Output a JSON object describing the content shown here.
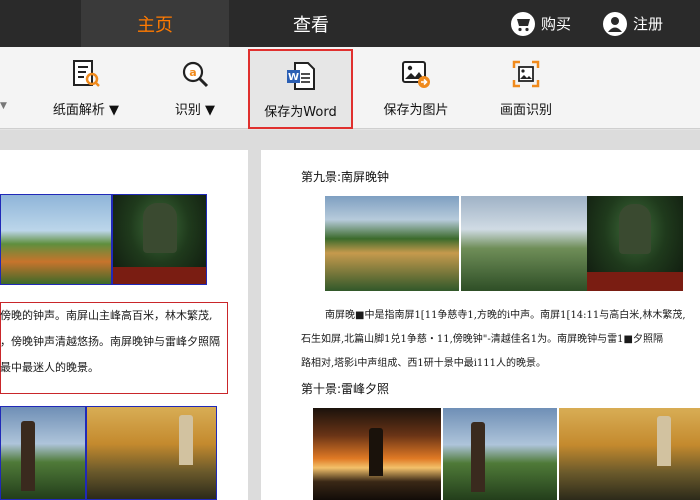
{
  "topbar": {
    "tabs": [
      {
        "label": "主页",
        "active": true
      },
      {
        "label": "查看",
        "active": false
      }
    ],
    "buy_label": "购买",
    "register_label": "注册"
  },
  "ribbon": {
    "buttons": [
      {
        "label": "纸面解析 ▼",
        "icon": "doc-search-icon"
      },
      {
        "label": "识别 ▼",
        "icon": "ocr-magnifier-icon"
      },
      {
        "label": "保存为Word",
        "icon": "word-doc-icon",
        "highlighted": true
      },
      {
        "label": "保存为图片",
        "icon": "save-image-icon"
      },
      {
        "label": "画面识别",
        "icon": "screen-capture-icon"
      }
    ],
    "left_arrow": "▼"
  },
  "left_page": {
    "text_lines": [
      "傍晚的钟声。南屏山主峰高百米，林木繁茂,",
      "，傍晚钟声清越悠扬。南屏晚钟与雷峰夕照隔",
      "最中最迷人的晚景。"
    ]
  },
  "right_page": {
    "heading9": "第九景:南屏晚钟",
    "ocr_lines": [
      "南屏晚■中是指南屏1[11争慈寺1,方晚的i中声。南屏1[14:11与高白米,林木繁茂,",
      "石生如屏,北篇山脚1兑1争慈・11,傍晚钟\"-清越佳名1为。南屏晚钟与雷1■夕照隔",
      "路相对,塔影i中声组成、西1研十景中最i111人的晚景。"
    ],
    "heading10": "第十景:雷峰夕照"
  },
  "colors": {
    "topbar_bg": "#2a2a2a",
    "active_tab": "#ff7a00",
    "highlight_border": "#e0302e",
    "ocr_red": "#c0282a"
  }
}
